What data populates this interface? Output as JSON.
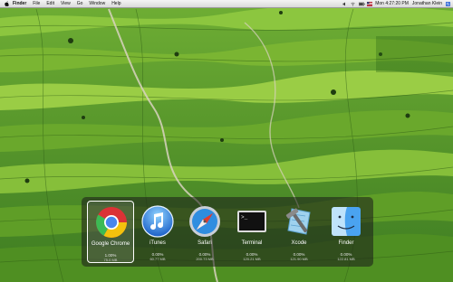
{
  "menubar": {
    "app_name": "Finder",
    "items": [
      "File",
      "Edit",
      "View",
      "Go",
      "Window",
      "Help"
    ],
    "clock": "Mon 4:27:20 PM",
    "user": "Jonathan Klein",
    "icons": [
      "apple-icon",
      "volume-icon",
      "wifi-icon",
      "battery-icon",
      "flag-icon",
      "spotlight-icon"
    ]
  },
  "switcher": {
    "selected": "Google Chrome",
    "apps": [
      {
        "name": "Google Chrome",
        "cpu": "1.00%",
        "mem": "75.0 MB",
        "icon": "chrome-icon"
      },
      {
        "name": "iTunes",
        "cpu": "0.00%",
        "mem": "60.77 MB",
        "icon": "itunes-icon"
      },
      {
        "name": "Safari",
        "cpu": "0.00%",
        "mem": "200.73 MB",
        "icon": "safari-icon"
      },
      {
        "name": "Terminal",
        "cpu": "0.00%",
        "mem": "120.21 MB",
        "icon": "terminal-icon"
      },
      {
        "name": "Xcode",
        "cpu": "0.00%",
        "mem": "121.90 MB",
        "icon": "xcode-icon"
      },
      {
        "name": "Finder",
        "cpu": "0.00%",
        "mem": "122.81 MB",
        "icon": "finder-icon"
      }
    ]
  }
}
